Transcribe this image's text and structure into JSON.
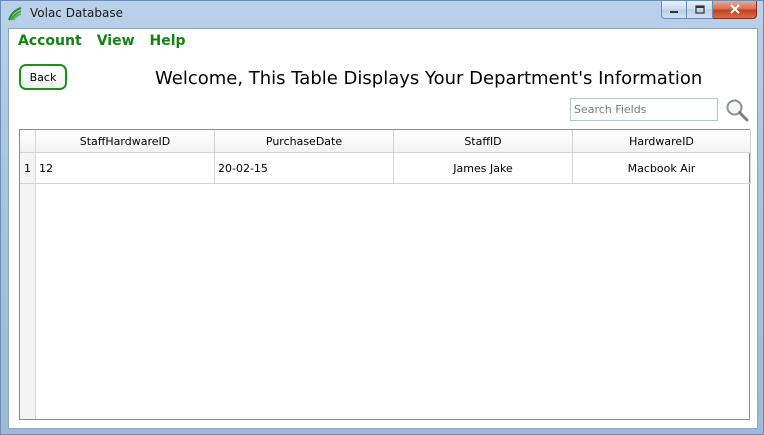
{
  "window": {
    "title": "Volac Database"
  },
  "menu": {
    "items": [
      "Account",
      "View",
      "Help"
    ]
  },
  "toolbar": {
    "back_label": "Back"
  },
  "heading": "Welcome, This Table Displays Your Department's Information",
  "search": {
    "placeholder": "Search Fields",
    "value": ""
  },
  "table": {
    "columns": [
      "StaffHardwareID",
      "PurchaseDate",
      "StaffID",
      "HardwareID"
    ],
    "rows": [
      {
        "row_number": "1",
        "cells": [
          "12",
          "20-02-15",
          "James Jake",
          "Macbook Air"
        ]
      }
    ]
  },
  "colors": {
    "accent_green": "#128312",
    "button_border": "#1e8f1e",
    "close_button": "#c2401f"
  },
  "icons": [
    "app-icon",
    "minimize-icon",
    "maximize-icon",
    "close-icon",
    "search-icon"
  ]
}
